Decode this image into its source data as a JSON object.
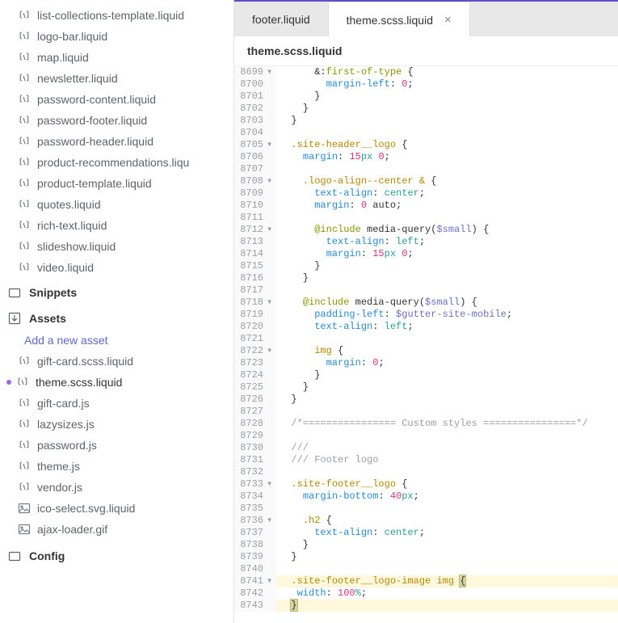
{
  "sidebar": {
    "files_top": [
      "list-collections-template.liquid",
      "logo-bar.liquid",
      "map.liquid",
      "newsletter.liquid",
      "password-content.liquid",
      "password-footer.liquid",
      "password-header.liquid",
      "product-recommendations.liqu",
      "product-template.liquid",
      "quotes.liquid",
      "rich-text.liquid",
      "slideshow.liquid",
      "video.liquid"
    ],
    "snippets_label": "Snippets",
    "assets_label": "Assets",
    "add_asset_label": "Add a new asset",
    "asset_files": [
      {
        "name": "gift-card.scss.liquid",
        "type": "liquid",
        "modified": false
      },
      {
        "name": "theme.scss.liquid",
        "type": "liquid",
        "modified": true
      },
      {
        "name": "gift-card.js",
        "type": "liquid",
        "modified": false
      },
      {
        "name": "lazysizes.js",
        "type": "liquid",
        "modified": false
      },
      {
        "name": "password.js",
        "type": "liquid",
        "modified": false
      },
      {
        "name": "theme.js",
        "type": "liquid",
        "modified": false
      },
      {
        "name": "vendor.js",
        "type": "liquid",
        "modified": false
      },
      {
        "name": "ico-select.svg.liquid",
        "type": "image",
        "modified": false
      },
      {
        "name": "ajax-loader.gif",
        "type": "image",
        "modified": false
      }
    ],
    "config_label": "Config"
  },
  "tabs": [
    {
      "label": "footer.liquid",
      "active": false
    },
    {
      "label": "theme.scss.liquid",
      "active": true
    }
  ],
  "open_file_label": "theme.scss.liquid",
  "code": [
    {
      "n": 8699,
      "fold": "▾",
      "segs": [
        [
          "      ",
          ""
        ],
        [
          "&",
          ".k-sel"
        ],
        [
          ":",
          "k-br"
        ],
        [
          "first-of-type",
          "k-at"
        ],
        [
          " {",
          "k-br"
        ]
      ]
    },
    {
      "n": 8700,
      "segs": [
        [
          "        ",
          ""
        ],
        [
          "margin-left",
          "k-prop"
        ],
        [
          ": ",
          "k-br"
        ],
        [
          "0",
          "k-num"
        ],
        [
          ";",
          "k-br"
        ]
      ]
    },
    {
      "n": 8701,
      "segs": [
        [
          "      }",
          "k-br"
        ]
      ]
    },
    {
      "n": 8702,
      "segs": [
        [
          "    }",
          "k-br"
        ]
      ]
    },
    {
      "n": 8703,
      "segs": [
        [
          "  }",
          "k-br"
        ]
      ]
    },
    {
      "n": 8704,
      "segs": [
        [
          "",
          ""
        ]
      ]
    },
    {
      "n": 8705,
      "fold": "▾",
      "segs": [
        [
          "  ",
          ""
        ],
        [
          ".site-header__logo",
          "k-sel"
        ],
        [
          " {",
          "k-br"
        ]
      ]
    },
    {
      "n": 8706,
      "segs": [
        [
          "    ",
          ""
        ],
        [
          "margin",
          "k-prop"
        ],
        [
          ": ",
          "k-br"
        ],
        [
          "15",
          "k-num"
        ],
        [
          "px ",
          "k-fn"
        ],
        [
          "0",
          "k-num"
        ],
        [
          ";",
          "k-br"
        ]
      ]
    },
    {
      "n": 8707,
      "segs": [
        [
          "",
          ""
        ]
      ]
    },
    {
      "n": 8708,
      "fold": "▾",
      "segs": [
        [
          "    ",
          ""
        ],
        [
          ".logo-align--center",
          "k-sel"
        ],
        [
          " ",
          ""
        ],
        [
          "&",
          "k-sel"
        ],
        [
          " {",
          "k-br"
        ]
      ]
    },
    {
      "n": 8709,
      "segs": [
        [
          "      ",
          ""
        ],
        [
          "text-align",
          "k-prop"
        ],
        [
          ": ",
          "k-br"
        ],
        [
          "center",
          "k-fn"
        ],
        [
          ";",
          "k-br"
        ]
      ]
    },
    {
      "n": 8710,
      "segs": [
        [
          "      ",
          ""
        ],
        [
          "margin",
          "k-prop"
        ],
        [
          ": ",
          "k-br"
        ],
        [
          "0",
          "k-num"
        ],
        [
          " auto",
          ""
        ],
        [
          ";",
          "k-br"
        ]
      ]
    },
    {
      "n": 8711,
      "segs": [
        [
          "",
          ""
        ]
      ]
    },
    {
      "n": 8712,
      "fold": "▾",
      "segs": [
        [
          "      ",
          ""
        ],
        [
          "@include",
          "k-at"
        ],
        [
          " media-query(",
          ""
        ],
        [
          "$small",
          "k-var"
        ],
        [
          ") {",
          "k-br"
        ]
      ]
    },
    {
      "n": 8713,
      "segs": [
        [
          "        ",
          ""
        ],
        [
          "text-align",
          "k-prop"
        ],
        [
          ": ",
          "k-br"
        ],
        [
          "left",
          "k-fn"
        ],
        [
          ";",
          "k-br"
        ]
      ]
    },
    {
      "n": 8714,
      "segs": [
        [
          "        ",
          ""
        ],
        [
          "margin",
          "k-prop"
        ],
        [
          ": ",
          "k-br"
        ],
        [
          "15",
          "k-num"
        ],
        [
          "px ",
          "k-fn"
        ],
        [
          "0",
          "k-num"
        ],
        [
          ";",
          "k-br"
        ]
      ]
    },
    {
      "n": 8715,
      "segs": [
        [
          "      }",
          "k-br"
        ]
      ]
    },
    {
      "n": 8716,
      "segs": [
        [
          "    }",
          "k-br"
        ]
      ]
    },
    {
      "n": 8717,
      "segs": [
        [
          "",
          ""
        ]
      ]
    },
    {
      "n": 8718,
      "fold": "▾",
      "segs": [
        [
          "    ",
          ""
        ],
        [
          "@include",
          "k-at"
        ],
        [
          " media-query(",
          ""
        ],
        [
          "$small",
          "k-var"
        ],
        [
          ") {",
          "k-br"
        ]
      ]
    },
    {
      "n": 8719,
      "segs": [
        [
          "      ",
          ""
        ],
        [
          "padding-left",
          "k-prop"
        ],
        [
          ": ",
          "k-br"
        ],
        [
          "$gutter-site-mobile",
          "k-var"
        ],
        [
          ";",
          "k-br"
        ]
      ]
    },
    {
      "n": 8720,
      "segs": [
        [
          "      ",
          ""
        ],
        [
          "text-align",
          "k-prop"
        ],
        [
          ": ",
          "k-br"
        ],
        [
          "left",
          "k-fn"
        ],
        [
          ";",
          "k-br"
        ]
      ]
    },
    {
      "n": 8721,
      "segs": [
        [
          "",
          ""
        ]
      ]
    },
    {
      "n": 8722,
      "fold": "▾",
      "segs": [
        [
          "      ",
          ""
        ],
        [
          "img",
          "k-sel"
        ],
        [
          " {",
          "k-br"
        ]
      ]
    },
    {
      "n": 8723,
      "segs": [
        [
          "        ",
          ""
        ],
        [
          "margin",
          "k-prop"
        ],
        [
          ": ",
          "k-br"
        ],
        [
          "0",
          "k-num"
        ],
        [
          ";",
          "k-br"
        ]
      ]
    },
    {
      "n": 8724,
      "segs": [
        [
          "      }",
          "k-br"
        ]
      ]
    },
    {
      "n": 8725,
      "segs": [
        [
          "    }",
          "k-br"
        ]
      ]
    },
    {
      "n": 8726,
      "segs": [
        [
          "  }",
          "k-br"
        ]
      ]
    },
    {
      "n": 8727,
      "segs": [
        [
          "",
          ""
        ]
      ]
    },
    {
      "n": 8728,
      "segs": [
        [
          "  /*================ Custom styles ================*/",
          "k-cm"
        ]
      ]
    },
    {
      "n": 8729,
      "segs": [
        [
          "",
          ""
        ]
      ]
    },
    {
      "n": 8730,
      "segs": [
        [
          "  ///",
          "k-cm"
        ]
      ]
    },
    {
      "n": 8731,
      "segs": [
        [
          "  /// Footer logo",
          "k-cm"
        ]
      ]
    },
    {
      "n": 8732,
      "segs": [
        [
          "",
          ""
        ]
      ]
    },
    {
      "n": 8733,
      "fold": "▾",
      "segs": [
        [
          "  ",
          ""
        ],
        [
          ".site-footer__logo",
          "k-sel"
        ],
        [
          " {",
          "k-br"
        ]
      ]
    },
    {
      "n": 8734,
      "segs": [
        [
          "    ",
          ""
        ],
        [
          "margin-bottom",
          "k-prop"
        ],
        [
          ": ",
          "k-br"
        ],
        [
          "40",
          "k-num"
        ],
        [
          "px",
          "k-fn"
        ],
        [
          ";",
          "k-br"
        ]
      ]
    },
    {
      "n": 8735,
      "segs": [
        [
          "",
          ""
        ]
      ]
    },
    {
      "n": 8736,
      "fold": "▾",
      "segs": [
        [
          "    ",
          ""
        ],
        [
          ".h2",
          "k-sel"
        ],
        [
          " {",
          "k-br"
        ]
      ]
    },
    {
      "n": 8737,
      "segs": [
        [
          "      ",
          ""
        ],
        [
          "text-align",
          "k-prop"
        ],
        [
          ": ",
          "k-br"
        ],
        [
          "center",
          "k-fn"
        ],
        [
          ";",
          "k-br"
        ]
      ]
    },
    {
      "n": 8738,
      "segs": [
        [
          "    }",
          "k-br"
        ]
      ]
    },
    {
      "n": 8739,
      "segs": [
        [
          "  }",
          "k-br"
        ]
      ]
    },
    {
      "n": 8740,
      "segs": [
        [
          "",
          ""
        ]
      ]
    },
    {
      "n": 8741,
      "fold": "▾",
      "hl": true,
      "segs": [
        [
          "  ",
          ""
        ],
        [
          ".site-footer__logo-image",
          "k-sel"
        ],
        [
          " ",
          ""
        ],
        [
          "img",
          "k-sel"
        ],
        [
          " ",
          ""
        ],
        [
          "{",
          "k-br hl-brace"
        ]
      ]
    },
    {
      "n": 8742,
      "segs": [
        [
          "   ",
          ""
        ],
        [
          "width",
          "k-prop"
        ],
        [
          ": ",
          "k-br"
        ],
        [
          "100",
          "k-num"
        ],
        [
          "%",
          "k-fn"
        ],
        [
          ";",
          "k-br"
        ]
      ]
    },
    {
      "n": 8743,
      "hl": true,
      "segs": [
        [
          "  ",
          ""
        ],
        [
          "}",
          "k-br hl-brace"
        ]
      ]
    }
  ]
}
